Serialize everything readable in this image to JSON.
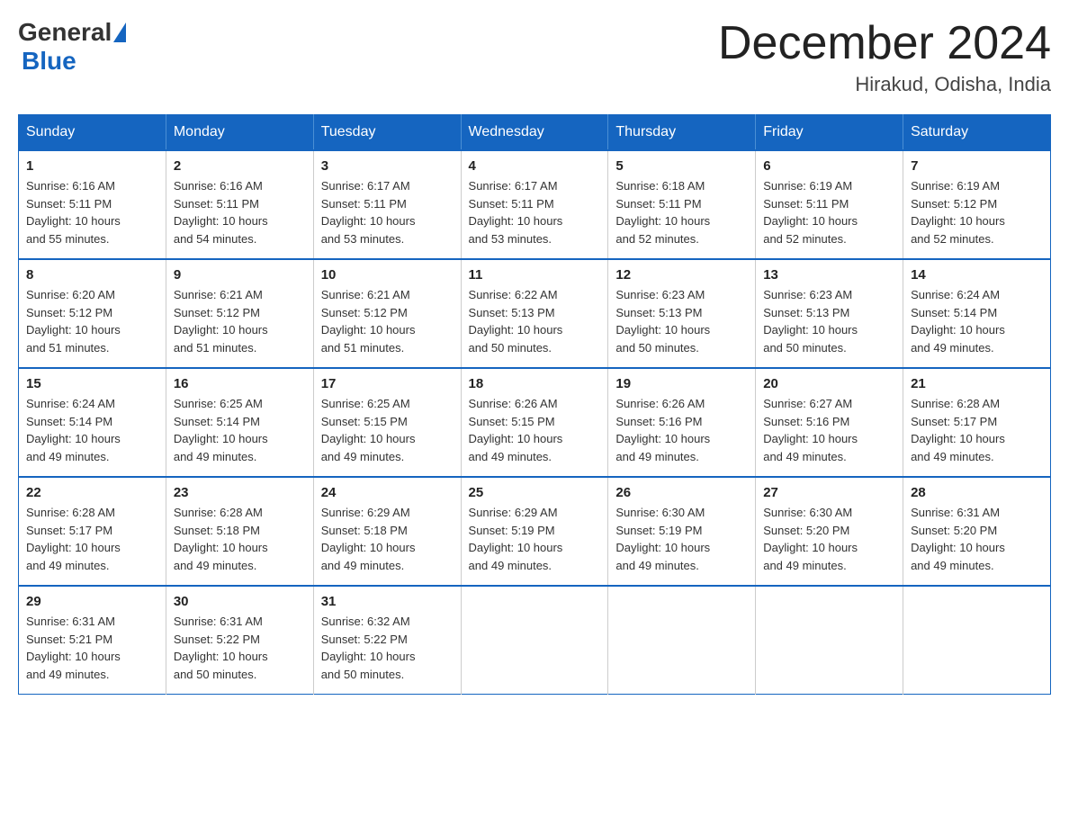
{
  "logo": {
    "general": "General",
    "blue": "Blue"
  },
  "title": "December 2024",
  "location": "Hirakud, Odisha, India",
  "days_of_week": [
    "Sunday",
    "Monday",
    "Tuesday",
    "Wednesday",
    "Thursday",
    "Friday",
    "Saturday"
  ],
  "weeks": [
    [
      {
        "day": "1",
        "sunrise": "6:16 AM",
        "sunset": "5:11 PM",
        "daylight": "10 hours and 55 minutes."
      },
      {
        "day": "2",
        "sunrise": "6:16 AM",
        "sunset": "5:11 PM",
        "daylight": "10 hours and 54 minutes."
      },
      {
        "day": "3",
        "sunrise": "6:17 AM",
        "sunset": "5:11 PM",
        "daylight": "10 hours and 53 minutes."
      },
      {
        "day": "4",
        "sunrise": "6:17 AM",
        "sunset": "5:11 PM",
        "daylight": "10 hours and 53 minutes."
      },
      {
        "day": "5",
        "sunrise": "6:18 AM",
        "sunset": "5:11 PM",
        "daylight": "10 hours and 52 minutes."
      },
      {
        "day": "6",
        "sunrise": "6:19 AM",
        "sunset": "5:11 PM",
        "daylight": "10 hours and 52 minutes."
      },
      {
        "day": "7",
        "sunrise": "6:19 AM",
        "sunset": "5:12 PM",
        "daylight": "10 hours and 52 minutes."
      }
    ],
    [
      {
        "day": "8",
        "sunrise": "6:20 AM",
        "sunset": "5:12 PM",
        "daylight": "10 hours and 51 minutes."
      },
      {
        "day": "9",
        "sunrise": "6:21 AM",
        "sunset": "5:12 PM",
        "daylight": "10 hours and 51 minutes."
      },
      {
        "day": "10",
        "sunrise": "6:21 AM",
        "sunset": "5:12 PM",
        "daylight": "10 hours and 51 minutes."
      },
      {
        "day": "11",
        "sunrise": "6:22 AM",
        "sunset": "5:13 PM",
        "daylight": "10 hours and 50 minutes."
      },
      {
        "day": "12",
        "sunrise": "6:23 AM",
        "sunset": "5:13 PM",
        "daylight": "10 hours and 50 minutes."
      },
      {
        "day": "13",
        "sunrise": "6:23 AM",
        "sunset": "5:13 PM",
        "daylight": "10 hours and 50 minutes."
      },
      {
        "day": "14",
        "sunrise": "6:24 AM",
        "sunset": "5:14 PM",
        "daylight": "10 hours and 49 minutes."
      }
    ],
    [
      {
        "day": "15",
        "sunrise": "6:24 AM",
        "sunset": "5:14 PM",
        "daylight": "10 hours and 49 minutes."
      },
      {
        "day": "16",
        "sunrise": "6:25 AM",
        "sunset": "5:14 PM",
        "daylight": "10 hours and 49 minutes."
      },
      {
        "day": "17",
        "sunrise": "6:25 AM",
        "sunset": "5:15 PM",
        "daylight": "10 hours and 49 minutes."
      },
      {
        "day": "18",
        "sunrise": "6:26 AM",
        "sunset": "5:15 PM",
        "daylight": "10 hours and 49 minutes."
      },
      {
        "day": "19",
        "sunrise": "6:26 AM",
        "sunset": "5:16 PM",
        "daylight": "10 hours and 49 minutes."
      },
      {
        "day": "20",
        "sunrise": "6:27 AM",
        "sunset": "5:16 PM",
        "daylight": "10 hours and 49 minutes."
      },
      {
        "day": "21",
        "sunrise": "6:28 AM",
        "sunset": "5:17 PM",
        "daylight": "10 hours and 49 minutes."
      }
    ],
    [
      {
        "day": "22",
        "sunrise": "6:28 AM",
        "sunset": "5:17 PM",
        "daylight": "10 hours and 49 minutes."
      },
      {
        "day": "23",
        "sunrise": "6:28 AM",
        "sunset": "5:18 PM",
        "daylight": "10 hours and 49 minutes."
      },
      {
        "day": "24",
        "sunrise": "6:29 AM",
        "sunset": "5:18 PM",
        "daylight": "10 hours and 49 minutes."
      },
      {
        "day": "25",
        "sunrise": "6:29 AM",
        "sunset": "5:19 PM",
        "daylight": "10 hours and 49 minutes."
      },
      {
        "day": "26",
        "sunrise": "6:30 AM",
        "sunset": "5:19 PM",
        "daylight": "10 hours and 49 minutes."
      },
      {
        "day": "27",
        "sunrise": "6:30 AM",
        "sunset": "5:20 PM",
        "daylight": "10 hours and 49 minutes."
      },
      {
        "day": "28",
        "sunrise": "6:31 AM",
        "sunset": "5:20 PM",
        "daylight": "10 hours and 49 minutes."
      }
    ],
    [
      {
        "day": "29",
        "sunrise": "6:31 AM",
        "sunset": "5:21 PM",
        "daylight": "10 hours and 49 minutes."
      },
      {
        "day": "30",
        "sunrise": "6:31 AM",
        "sunset": "5:22 PM",
        "daylight": "10 hours and 50 minutes."
      },
      {
        "day": "31",
        "sunrise": "6:32 AM",
        "sunset": "5:22 PM",
        "daylight": "10 hours and 50 minutes."
      },
      null,
      null,
      null,
      null
    ]
  ],
  "labels": {
    "sunrise": "Sunrise:",
    "sunset": "Sunset:",
    "daylight": "Daylight:"
  }
}
